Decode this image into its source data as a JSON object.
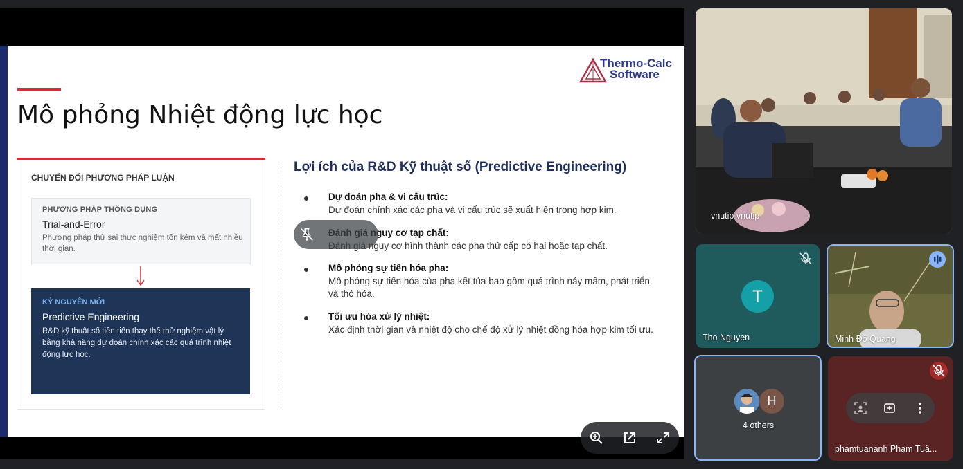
{
  "slide": {
    "title": "Mô phỏng Nhiệt động lực học",
    "logo": {
      "line1": "Thermo-Calc",
      "line2": "Software"
    },
    "card": {
      "heading": "CHUYỂN ĐỔI PHƯƠNG PHÁP LUẬN",
      "old": {
        "tag": "PHƯƠNG PHÁP THÔNG DỤNG",
        "title": "Trial-and-Error",
        "desc": "Phương pháp thử sai thực nghiệm tốn kém và mất nhiều thời gian."
      },
      "new": {
        "tag": "KỶ NGUYÊN MỚI",
        "title": "Predictive Engineering",
        "desc": "R&D kỹ thuật số tiên tiến thay thế thử nghiệm vật lý bằng khả năng dự đoán chính xác các quá trình nhiệt động lực học."
      }
    },
    "benefits": {
      "title": "Lợi ích của R&D Kỹ thuật số (Predictive Engineering)",
      "items": [
        {
          "head": "Dự đoán pha & vi cấu trúc:",
          "desc": "Dự đoán chính xác các pha và vi cấu trúc sẽ xuất hiện trong hợp kim."
        },
        {
          "head": "Đánh giá nguy cơ tạp chất:",
          "desc": "Đánh giá nguy cơ hình thành các pha thứ cấp có hại hoặc tạp chất."
        },
        {
          "head": "Mô phỏng sự tiến hóa pha:",
          "desc": "Mô phỏng sự tiến hóa của pha kết tủa bao gồm quá trình nảy mầm, phát triển và thô hóa."
        },
        {
          "head": "Tối ưu hóa xử lý nhiệt:",
          "desc": "Xác định thời gian và nhiệt độ cho chế độ xử lý nhiệt đồng hóa hợp kim tối ưu."
        }
      ]
    }
  },
  "participants": {
    "room": {
      "name": "vnutip vnutip"
    },
    "tho": {
      "name": "Tho Nguyen",
      "initial": "T",
      "muted": true
    },
    "minh": {
      "name": "Minh Đỗ Quang",
      "speaking": true
    },
    "others": {
      "label": "4 others",
      "initial": "H"
    },
    "pham": {
      "name": "phamtuananh Phạm Tuấ...",
      "muted": true
    }
  },
  "controls": {
    "unpin_icon": "unpin-icon",
    "zoom_icons": [
      "zoom-in-icon",
      "open-in-new-icon",
      "fullscreen-icon"
    ]
  },
  "colors": {
    "accent_red": "#d1303b",
    "navy": "#1f3558",
    "meet_blue": "#8ab4f8"
  }
}
